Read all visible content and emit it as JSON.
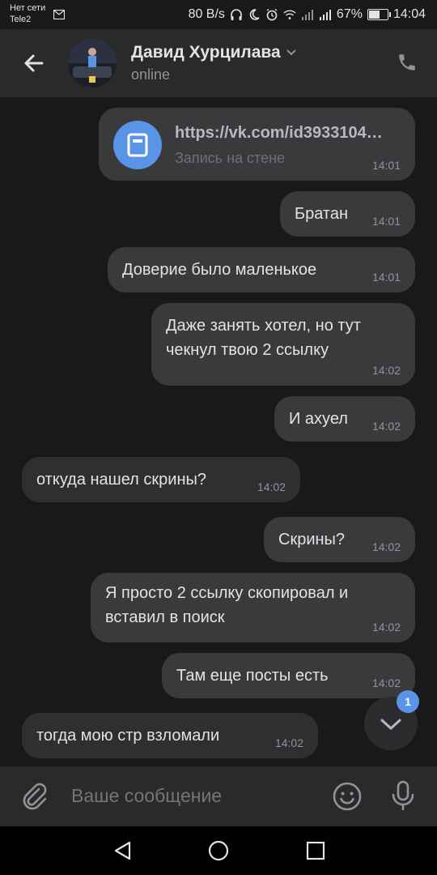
{
  "statusbar": {
    "carrier_line1": "Нет сети",
    "carrier_line2": "Tele2",
    "speed": "80 B/s",
    "battery": "67%",
    "battery_level": 0.67,
    "time": "14:04"
  },
  "header": {
    "name": "Давид Хурцилава",
    "status": "online"
  },
  "messages": [
    {
      "type": "link",
      "url": "https://vk.com/id3933104…",
      "subtitle": "Запись на стене",
      "time": "14:01",
      "direction": "out"
    },
    {
      "text": "Братан",
      "time": "14:01",
      "direction": "out"
    },
    {
      "text": "Доверие было маленькое",
      "time": "14:01",
      "direction": "out"
    },
    {
      "line1": "Даже занять хотел, но тут",
      "line2": "чекнул твою 2 ссылку",
      "time": "14:02",
      "direction": "out"
    },
    {
      "text": "И ахуел",
      "time": "14:02",
      "direction": "out"
    },
    {
      "text": "откуда нашел скрины?",
      "time": "14:02",
      "direction": "in"
    },
    {
      "text": "Скрины?",
      "time": "14:02",
      "direction": "out"
    },
    {
      "line1": "Я просто 2 ссылку скопировал и",
      "line2": "вставил в поиск",
      "time": "14:02",
      "direction": "out"
    },
    {
      "text": "Там еще посты есть",
      "time": "14:02",
      "direction": "out"
    },
    {
      "text": "тогда мою стр взломали",
      "time": "14:02",
      "direction": "in"
    }
  ],
  "scroll_badge": "1",
  "composer": {
    "placeholder": "Ваше сообщение"
  },
  "colors": {
    "accent": "#5a94e6",
    "bubble": "#3a3a3c",
    "background": "#19191a"
  }
}
